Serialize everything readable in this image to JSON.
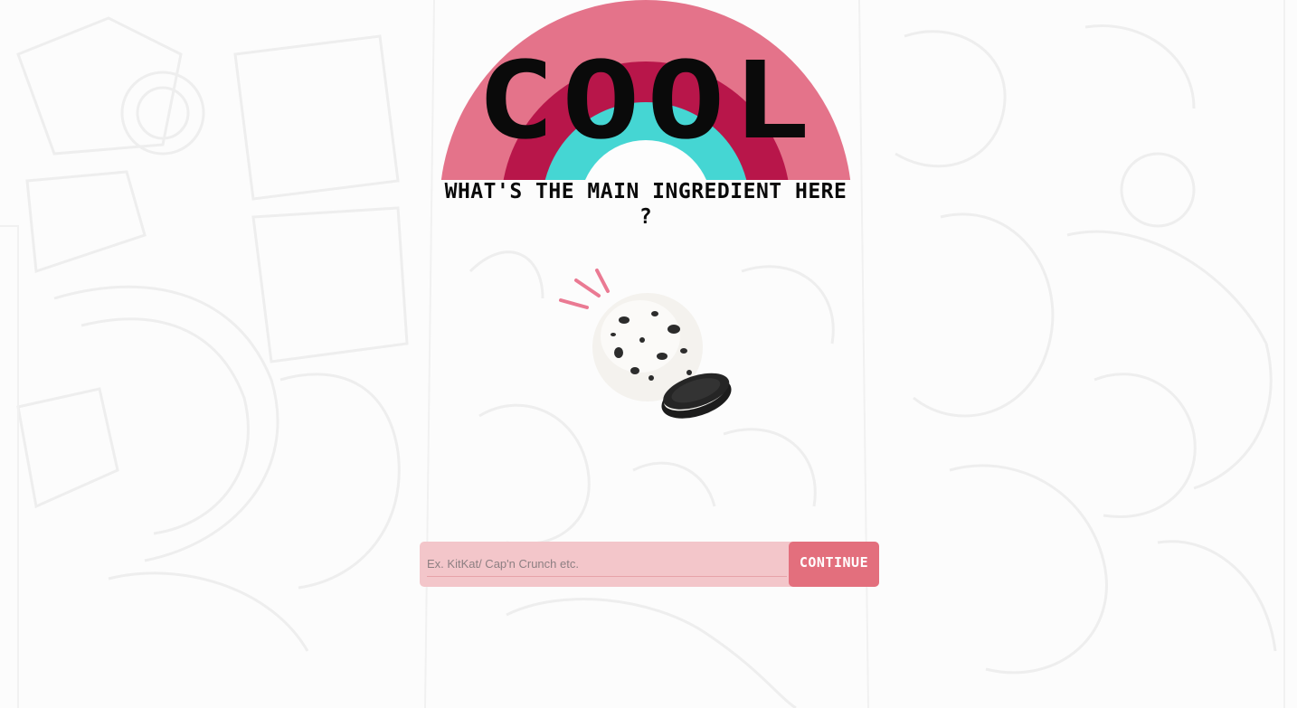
{
  "logo": {
    "text": "COOL"
  },
  "prompt": {
    "question": "What's the main ingredient here ?"
  },
  "illustration": {
    "icon": "cookies-and-cream-ice-cream-scoop"
  },
  "form": {
    "input_value": "",
    "input_placeholder": "Ex. KitKat/ Cap'n Crunch etc.",
    "continue_label": "CONTINUE"
  },
  "colors": {
    "outer_arc": "#e4738a",
    "middle_arc": "#b8164a",
    "inner_arc": "#45d6d3",
    "form_background": "#f3c6ca",
    "button": "#e36f7d"
  }
}
